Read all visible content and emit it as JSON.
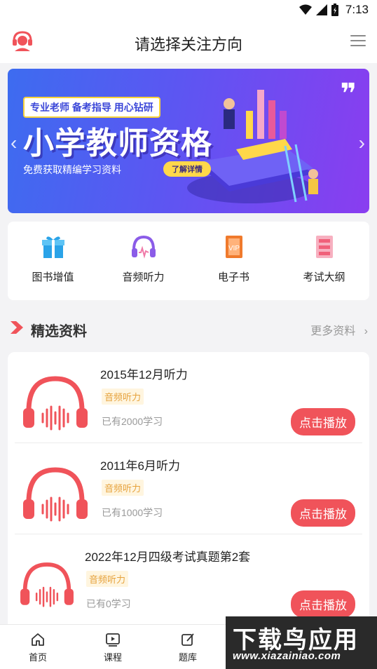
{
  "status_bar": {
    "time": "7:13",
    "wifi_icon": "wifi-icon",
    "signal_icon": "signal-icon",
    "battery_icon": "battery-icon"
  },
  "header": {
    "title": "请选择关注方向",
    "logo_icon": "customer-service-icon",
    "menu_icon": "menu-icon"
  },
  "banner": {
    "tagline": "专业老师 备考指导 用心钻研",
    "title": "小学教师资格",
    "subtitle": "免费获取精编学习资料",
    "button": "了解详情",
    "prev_icon": "chevron-left-icon",
    "next_icon": "chevron-right-icon"
  },
  "quick_menu": [
    {
      "label": "图书增值",
      "icon": "gift-icon",
      "color": "#2aa3e8"
    },
    {
      "label": "音频听力",
      "icon": "headphones-icon",
      "color": "#8b5ce8"
    },
    {
      "label": "电子书",
      "icon": "ebook-icon",
      "color": "#f07a2c"
    },
    {
      "label": "考试大纲",
      "icon": "outline-icon",
      "color": "#f0607a"
    }
  ],
  "section": {
    "title": "精选资料",
    "more": "更多资料",
    "more_icon": "chevron-right-icon"
  },
  "list": [
    {
      "title": "2015年12月听力",
      "tag": "音频听力",
      "count": "已有2000学习",
      "button": "点击播放"
    },
    {
      "title": "2011年6月听力",
      "tag": "音频听力",
      "count": "已有1000学习",
      "button": "点击播放"
    },
    {
      "title": "2022年12月四级考试真题第2套",
      "tag": "音频听力",
      "count": "已有0学习",
      "button": "点击播放"
    }
  ],
  "bottom_nav": [
    {
      "label": "首页",
      "icon": "home-icon"
    },
    {
      "label": "课程",
      "icon": "video-icon"
    },
    {
      "label": "题库",
      "icon": "edit-icon"
    }
  ],
  "watermark": {
    "text": "下载鸟应用",
    "url": "www.xiazainiao.com"
  },
  "colors": {
    "accent": "#f0535a",
    "tag_text": "#e6a23c",
    "tag_bg": "#fff5df"
  }
}
